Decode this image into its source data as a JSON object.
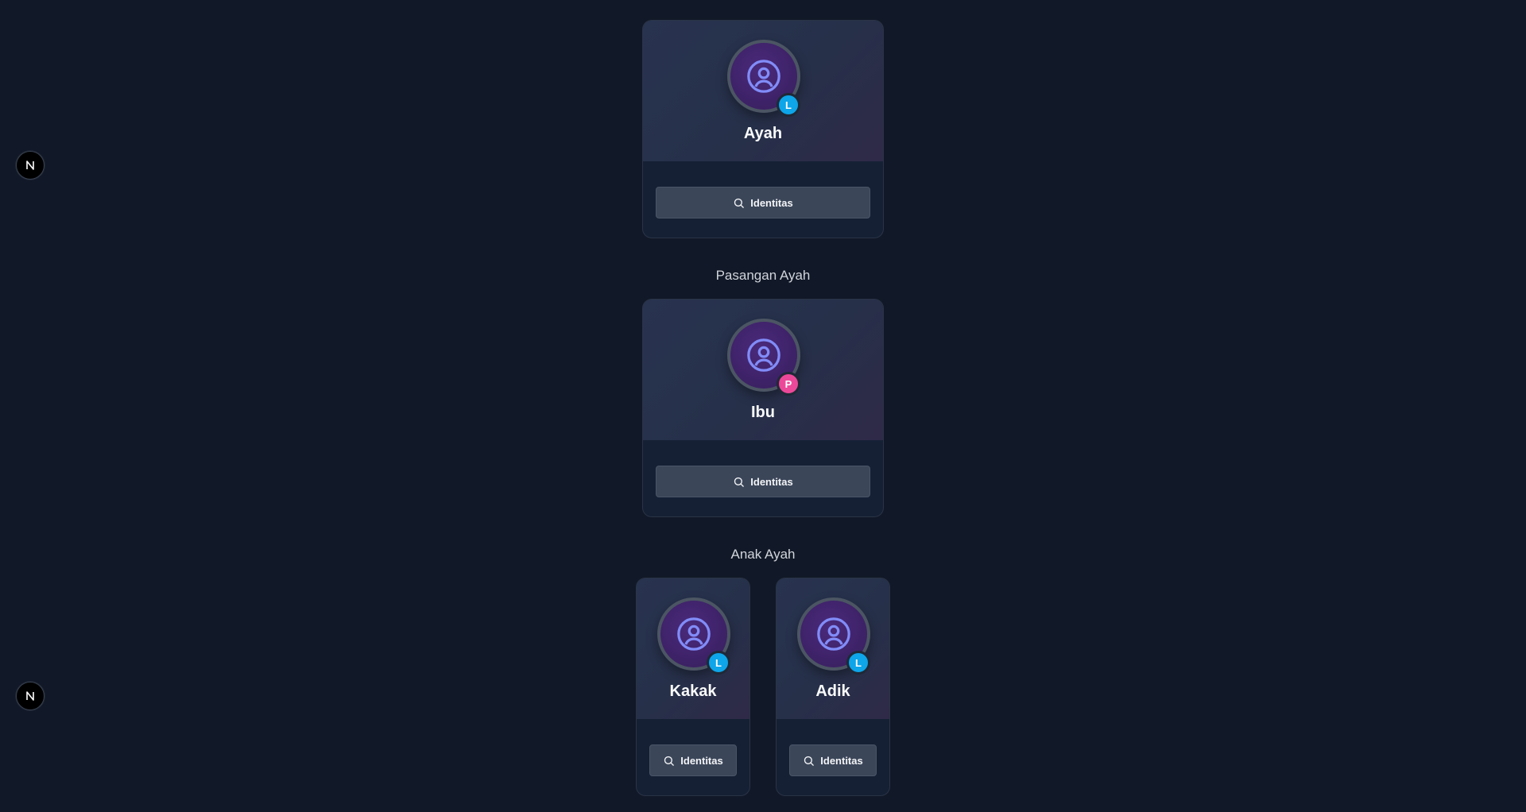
{
  "people": {
    "ayah": {
      "name": "Ayah",
      "gender_letter": "L",
      "button_label": "Identitas"
    },
    "ibu": {
      "name": "Ibu",
      "gender_letter": "P",
      "button_label": "Identitas"
    },
    "kakak": {
      "name": "Kakak",
      "gender_letter": "L",
      "button_label": "Identitas"
    },
    "adik": {
      "name": "Adik",
      "gender_letter": "L",
      "button_label": "Identitas"
    }
  },
  "sections": {
    "spouse_label": "Pasangan Ayah",
    "children_label": "Anak Ayah"
  },
  "colors": {
    "background": "#111827",
    "male_badge": "#0ea5e9",
    "female_badge": "#ec4899",
    "avatar_icon": "#818cf8"
  },
  "icons": {
    "avatar": "user-circle-icon",
    "button": "search-icon",
    "dev_badge": "nextjs-logo-icon"
  }
}
